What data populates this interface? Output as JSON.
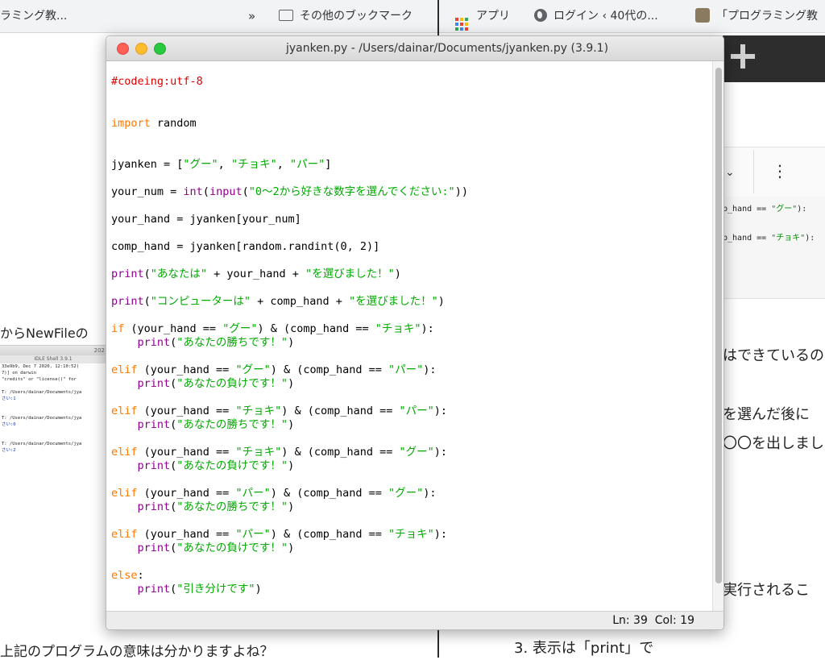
{
  "background": {
    "bookmarks_left": {
      "tab_fragment": "ラミング教...",
      "chevron": "»",
      "folder_label": "その他のブックマーク"
    },
    "bookmarks_right": {
      "apps_label": "アプリ",
      "login_label": "ログイン ‹ 40代の...",
      "bookmark3_label": "「プログラミング教"
    },
    "left_page": {
      "text": "からNewFileの",
      "mini_shell": {
        "title": "IDLE Shell 3.9.1",
        "year_fragment": "202",
        "lines": [
          "33e9b9, Dec  7 2020, 12:10:52)",
          "7)] on darwin",
          " \"credits\" or \"license()\" for",
          "",
          "T: /Users/dainar/Documents/jya",
          "さい:1",
          "",
          "",
          "T: /Users/dainar/Documents/jya",
          "さい:0",
          "",
          "",
          "T: /Users/dainar/Documents/jya",
          "さい:2"
        ]
      },
      "bottom_text": "上記のプログラムの意味は分かりますよね？"
    },
    "right_page": {
      "snippet1_pre": "p_hand == ",
      "snippet1_str": "\"グー\"",
      "snippet1_post": "):",
      "snippet2_pre": "p_hand == ",
      "snippet2_str": "\"チョキ\"",
      "snippet2_post": "):",
      "text1": "はできているの",
      "text2": "を選んだ後に",
      "text3": "〇〇を出しまし",
      "text4": "実行されるこ",
      "bottom_text": "3. 表示は「print」で"
    }
  },
  "idle": {
    "title": "jyanken.py - /Users/dainar/Documents/jyanken.py (3.9.1)",
    "code_lines": [
      [
        [
          "#codeing:utf-8",
          "comment"
        ]
      ],
      [],
      [
        [
          "import",
          "keyword"
        ],
        [
          " random",
          ""
        ]
      ],
      [],
      [
        [
          "jyanken = [",
          ""
        ],
        [
          "\"グー\"",
          "string"
        ],
        [
          ", ",
          ""
        ],
        [
          "\"チョキ\"",
          "string"
        ],
        [
          ", ",
          ""
        ],
        [
          "\"パー\"",
          "string"
        ],
        [
          "]",
          ""
        ]
      ],
      [
        [
          "your_num = ",
          ""
        ],
        [
          "int",
          "builtin"
        ],
        [
          "(",
          ""
        ],
        [
          "input",
          "builtin"
        ],
        [
          "(",
          ""
        ],
        [
          "\"0〜2から好きな数字を選んでください:\"",
          "string"
        ],
        [
          "))",
          ""
        ]
      ],
      [
        [
          "your_hand = jyanken[your_num]",
          ""
        ]
      ],
      [
        [
          "comp_hand = jyanken[random.randint(0, 2)]",
          ""
        ]
      ],
      [
        [
          "print",
          "builtin"
        ],
        [
          "(",
          ""
        ],
        [
          "\"あなたは\"",
          "string"
        ],
        [
          " + your_hand + ",
          ""
        ],
        [
          "\"を選びました！\"",
          "string"
        ],
        [
          ")",
          ""
        ]
      ],
      [
        [
          "print",
          "builtin"
        ],
        [
          "(",
          ""
        ],
        [
          "\"コンピューターは\"",
          "string"
        ],
        [
          " + comp_hand + ",
          ""
        ],
        [
          "\"を選びました！\"",
          "string"
        ],
        [
          ")",
          ""
        ]
      ],
      [
        [
          "if",
          "keyword"
        ],
        [
          " (your_hand == ",
          ""
        ],
        [
          "\"グー\"",
          "string"
        ],
        [
          ") & (comp_hand == ",
          ""
        ],
        [
          "\"チョキ\"",
          "string"
        ],
        [
          "):",
          ""
        ]
      ],
      [
        [
          "    ",
          ""
        ],
        [
          "print",
          "builtin"
        ],
        [
          "(",
          ""
        ],
        [
          "\"あなたの勝ちです！\"",
          "string"
        ],
        [
          ")",
          ""
        ]
      ],
      [
        [
          "elif",
          "keyword"
        ],
        [
          " (your_hand == ",
          ""
        ],
        [
          "\"グー\"",
          "string"
        ],
        [
          ") & (comp_hand == ",
          ""
        ],
        [
          "\"パー\"",
          "string"
        ],
        [
          "):",
          ""
        ]
      ],
      [
        [
          "    ",
          ""
        ],
        [
          "print",
          "builtin"
        ],
        [
          "(",
          ""
        ],
        [
          "\"あなたの負けです！\"",
          "string"
        ],
        [
          ")",
          ""
        ]
      ],
      [
        [
          "elif",
          "keyword"
        ],
        [
          " (your_hand == ",
          ""
        ],
        [
          "\"チョキ\"",
          "string"
        ],
        [
          ") & (comp_hand == ",
          ""
        ],
        [
          "\"パー\"",
          "string"
        ],
        [
          "):",
          ""
        ]
      ],
      [
        [
          "    ",
          ""
        ],
        [
          "print",
          "builtin"
        ],
        [
          "(",
          ""
        ],
        [
          "\"あなたの勝ちです！\"",
          "string"
        ],
        [
          ")",
          ""
        ]
      ],
      [
        [
          "elif",
          "keyword"
        ],
        [
          " (your_hand == ",
          ""
        ],
        [
          "\"チョキ\"",
          "string"
        ],
        [
          ") & (comp_hand == ",
          ""
        ],
        [
          "\"グー\"",
          "string"
        ],
        [
          "):",
          ""
        ]
      ],
      [
        [
          "    ",
          ""
        ],
        [
          "print",
          "builtin"
        ],
        [
          "(",
          ""
        ],
        [
          "\"あなたの負けです！\"",
          "string"
        ],
        [
          ")",
          ""
        ]
      ],
      [
        [
          "elif",
          "keyword"
        ],
        [
          " (your_hand == ",
          ""
        ],
        [
          "\"パー\"",
          "string"
        ],
        [
          ") & (comp_hand == ",
          ""
        ],
        [
          "\"グー\"",
          "string"
        ],
        [
          "):",
          ""
        ]
      ],
      [
        [
          "    ",
          ""
        ],
        [
          "print",
          "builtin"
        ],
        [
          "(",
          ""
        ],
        [
          "\"あなたの勝ちです！\"",
          "string"
        ],
        [
          ")",
          ""
        ]
      ],
      [
        [
          "elif",
          "keyword"
        ],
        [
          " (your_hand == ",
          ""
        ],
        [
          "\"パー\"",
          "string"
        ],
        [
          ") & (comp_hand == ",
          ""
        ],
        [
          "\"チョキ\"",
          "string"
        ],
        [
          "):",
          ""
        ]
      ],
      [
        [
          "    ",
          ""
        ],
        [
          "print",
          "builtin"
        ],
        [
          "(",
          ""
        ],
        [
          "\"あなたの負けです！\"",
          "string"
        ],
        [
          ")",
          ""
        ]
      ],
      [
        [
          "else",
          "keyword"
        ],
        [
          ":",
          ""
        ]
      ],
      [
        [
          "    ",
          ""
        ],
        [
          "print",
          "builtin"
        ],
        [
          "(",
          ""
        ],
        [
          "\"引き分けです\"",
          "string"
        ],
        [
          ")",
          ""
        ]
      ]
    ],
    "status": {
      "ln_label": "Ln:",
      "ln_value": "39",
      "col_label": "Col:",
      "col_value": "19"
    }
  },
  "colors": {
    "comment": "#dd0000",
    "keyword": "#ff7700",
    "builtin": "#900090",
    "string": "#00aa00",
    "close": "#fe5f57",
    "minimize": "#febc2e",
    "maximize": "#28c840"
  }
}
